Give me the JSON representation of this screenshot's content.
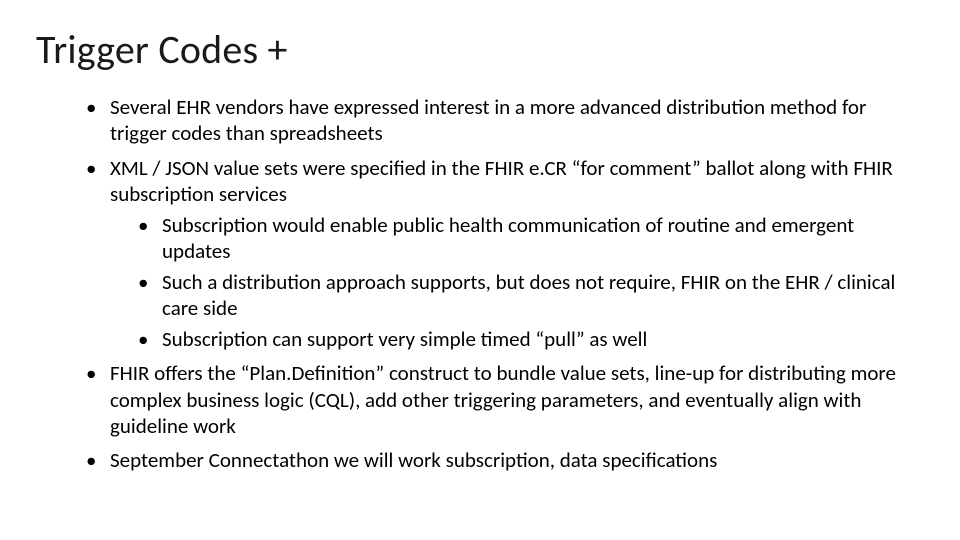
{
  "slide": {
    "title": "Trigger Codes +",
    "bullets": [
      {
        "text": "Several EHR vendors have expressed interest in a more advanced distribution method for trigger codes than spreadsheets"
      },
      {
        "text": "XML / JSON value sets were specified in the FHIR e.CR “for comment” ballot along with FHIR subscription services",
        "children": [
          {
            "text": "Subscription would enable public health communication of routine and emergent updates"
          },
          {
            "text": "Such a distribution approach supports, but does not require, FHIR on the EHR / clinical care side"
          },
          {
            "text": "Subscription can support very simple timed “pull” as well"
          }
        ]
      },
      {
        "text": "FHIR offers the “Plan.Definition” construct to bundle value sets, line-up for distributing more complex business logic (CQL), add other triggering parameters, and eventually align with guideline work"
      },
      {
        "text": "September Connectathon we will work subscription, data specifications"
      }
    ]
  }
}
